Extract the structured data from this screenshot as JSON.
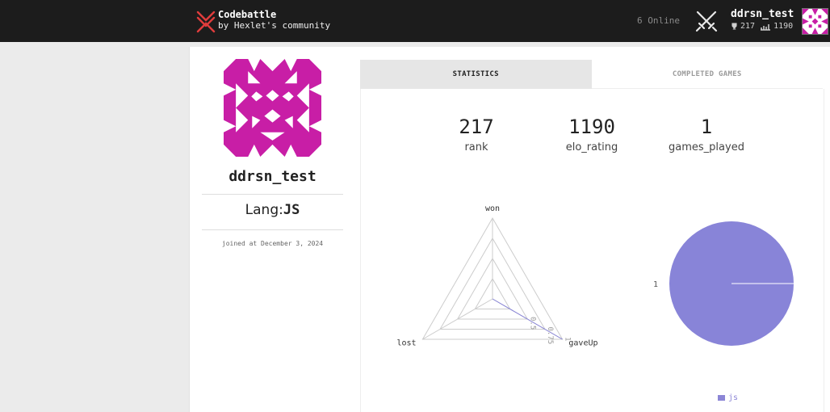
{
  "nav": {
    "brand_title": "Codebattle",
    "brand_subtitle": "by Hexlet's community",
    "online": "6 Online",
    "username": "ddrsn_test",
    "rank": "217",
    "rating": "1190",
    "icons": [
      "codebattle-logo-icon",
      "crossed-swords-icon",
      "trophy-icon",
      "rating-chart-icon"
    ],
    "brand_color": "#e03c3c"
  },
  "profile": {
    "username": "ddrsn_test",
    "lang_label": "Lang:",
    "lang": "JS",
    "joined": "joined at December 3, 2024",
    "avatar_color": "#c81ea6"
  },
  "tabs": [
    {
      "label": "STATISTICS",
      "active": true
    },
    {
      "label": "COMPLETED GAMES",
      "active": false
    }
  ],
  "stats": [
    {
      "value": "217",
      "label": "rank"
    },
    {
      "value": "1190",
      "label": "elo_rating"
    },
    {
      "value": "1",
      "label": "games_played"
    }
  ],
  "chart_data": [
    {
      "type": "radar",
      "axes": [
        "won",
        "gaveUp",
        "lost"
      ],
      "series": [
        {
          "values": [
            0,
            1,
            0
          ]
        }
      ],
      "ticks": [
        "0.5",
        "0.75",
        "1"
      ],
      "range": [
        0,
        1
      ],
      "color": "#8884d8"
    },
    {
      "type": "pie",
      "series": [
        {
          "values": [
            1
          ]
        }
      ],
      "labels": [
        "1"
      ],
      "legend": [
        "js"
      ],
      "legend_position": "bottom",
      "color": "#8884d8"
    }
  ]
}
